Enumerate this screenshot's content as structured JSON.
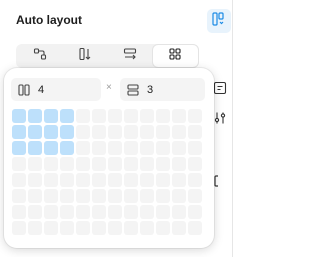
{
  "panel": {
    "title": "Auto layout"
  },
  "icons": {
    "auto_layout_toggle": "auto-layout-icon",
    "directions": [
      "wrap-icon",
      "vertical-icon",
      "horizontal-icon",
      "grid-icon"
    ],
    "side": [
      "alignment-icon",
      "tune-icon",
      "clip-icon"
    ],
    "columns": "columns-icon",
    "rows": "rows-icon"
  },
  "grid_popover": {
    "columns_value": "4",
    "rows_value": "3",
    "times": "×",
    "total_columns": 12,
    "total_rows": 8,
    "selected_columns": 4,
    "selected_rows": 3
  },
  "colors": {
    "accent": "#1a8ae6",
    "accent_bg": "#e8f3fc",
    "cell_selected": "#bde0fb",
    "cell": "#f4f4f4"
  }
}
